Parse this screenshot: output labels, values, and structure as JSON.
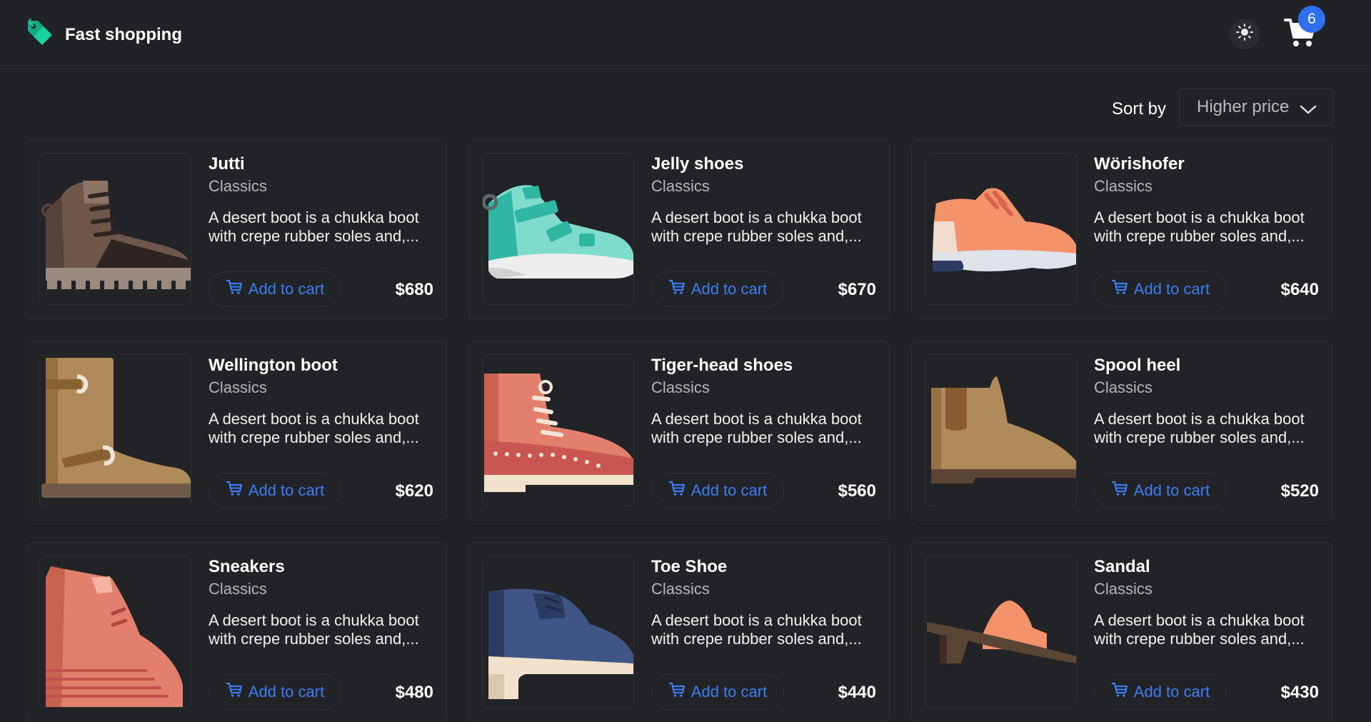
{
  "header": {
    "brand": "Fast shopping",
    "theme_icon": "sun-icon",
    "cart_icon": "cart-icon",
    "cart_count": "6"
  },
  "sort": {
    "label": "Sort by",
    "selected": "Higher price"
  },
  "colors": {
    "background": "#212225",
    "accent": "#3b7ef6",
    "badge": "#2f6ff0",
    "brand_icon": "#19d3a2"
  },
  "products": [
    {
      "name": "Jutti",
      "category": "Classics",
      "description": "A desert boot is a chukka boot with crepe rubber soles and,...",
      "button": "Add to cart",
      "price": "$680",
      "image": "brown-hiking-boot"
    },
    {
      "name": "Jelly shoes",
      "category": "Classics",
      "description": "A desert boot is a chukka boot with crepe rubber soles and,...",
      "button": "Add to cart",
      "price": "$670",
      "image": "teal-high-top-sneaker"
    },
    {
      "name": "Wörishofer",
      "category": "Classics",
      "description": "A desert boot is a chukka boot with crepe rubber soles and,...",
      "button": "Add to cart",
      "price": "$640",
      "image": "orange-running-shoe"
    },
    {
      "name": "Wellington boot",
      "category": "Classics",
      "description": "A desert boot is a chukka boot with crepe rubber soles and,...",
      "button": "Add to cart",
      "price": "$620",
      "image": "tan-tall-boot"
    },
    {
      "name": "Tiger-head shoes",
      "category": "Classics",
      "description": "A desert boot is a chukka boot with crepe rubber soles and,...",
      "button": "Add to cart",
      "price": "$560",
      "image": "red-lace-boot"
    },
    {
      "name": "Spool heel",
      "category": "Classics",
      "description": "A desert boot is a chukka boot with crepe rubber soles and,...",
      "button": "Add to cart",
      "price": "$520",
      "image": "tan-chelsea-boot"
    },
    {
      "name": "Sneakers",
      "category": "Classics",
      "description": "A desert boot is a chukka boot with crepe rubber soles and,...",
      "button": "Add to cart",
      "price": "$480",
      "image": "red-wedge-sneaker"
    },
    {
      "name": "Toe Shoe",
      "category": "Classics",
      "description": "A desert boot is a chukka boot with crepe rubber soles and,...",
      "button": "Add to cart",
      "price": "$440",
      "image": "blue-heeled-oxford"
    },
    {
      "name": "Sandal",
      "category": "Classics",
      "description": "A desert boot is a chukka boot with crepe rubber soles and,...",
      "button": "Add to cart",
      "price": "$430",
      "image": "orange-heeled-sandal"
    }
  ]
}
